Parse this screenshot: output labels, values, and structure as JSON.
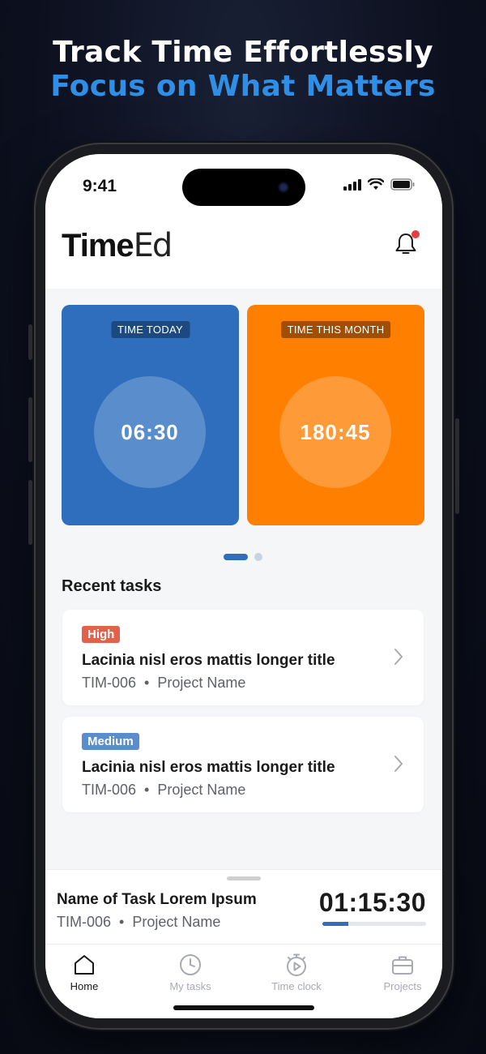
{
  "headline": {
    "line1": "Track Time Effortlessly",
    "line2": "Focus on What Matters"
  },
  "status_bar": {
    "time": "9:41",
    "icons": [
      "cellular-signal-icon",
      "wifi-icon",
      "battery-icon"
    ]
  },
  "header": {
    "logo_bold": "Time",
    "logo_thin": "Ed",
    "notification_icon": "bell-icon",
    "has_notification": true
  },
  "stats": [
    {
      "label": "TIME TODAY",
      "value": "06:30",
      "color": "#2e6ebd"
    },
    {
      "label": "TIME THIS MONTH",
      "value": "180:45",
      "color": "#ff7f00"
    }
  ],
  "pager": {
    "pages": 2,
    "active": 0
  },
  "recent": {
    "title": "Recent tasks",
    "tasks": [
      {
        "priority": "High",
        "title": "Lacinia nisl eros mattis longer title",
        "id": "TIM-006",
        "separator": "•",
        "project": "Project Name"
      },
      {
        "priority": "Medium",
        "title": "Lacinia nisl eros mattis longer title",
        "id": "TIM-006",
        "separator": "•",
        "project": "Project Name"
      }
    ]
  },
  "active_timer": {
    "task_name": "Name of Task Lorem Ipsum",
    "id": "TIM-006",
    "separator": "•",
    "project": "Project Name",
    "elapsed": "01:15:30",
    "progress": 0.25
  },
  "tabbar": {
    "active": "Home",
    "tabs": [
      {
        "label": "Home",
        "icon": "home-icon"
      },
      {
        "label": "My tasks",
        "icon": "clock-icon"
      },
      {
        "label": "Time clock",
        "icon": "stopwatch-play-icon"
      },
      {
        "label": "Projects",
        "icon": "briefcase-icon"
      }
    ]
  },
  "colors": {
    "accent_blue": "#2e6ebd",
    "accent_orange": "#ff7f00",
    "headline_blue": "#2f8fe6",
    "priority_high": "#e0624a",
    "priority_medium": "#5a8dcb"
  }
}
